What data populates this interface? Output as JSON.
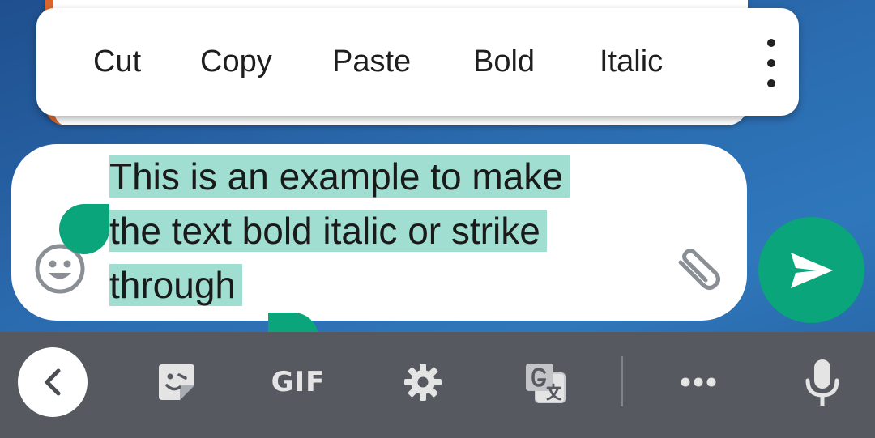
{
  "context_menu": {
    "items": [
      "Cut",
      "Copy",
      "Paste",
      "Bold",
      "Italic"
    ],
    "more_icon": "more-vert-icon"
  },
  "compose": {
    "lines": [
      "This is an example to make",
      "the text bold italic or strike",
      "through"
    ],
    "emoji_icon": "emoji-face-icon",
    "attach_icon": "paperclip-icon",
    "send_icon": "send-icon"
  },
  "keyboard_toolbar": {
    "back_icon": "chevron-left-icon",
    "sticker_icon": "sticker-icon",
    "gif_label": "GIF",
    "settings_icon": "gear-icon",
    "translate_icon": "translate-icon",
    "more_icon": "more-horiz-icon",
    "mic_icon": "microphone-icon"
  },
  "colors": {
    "accent_green": "#0aa57a",
    "selection": "#9fded0",
    "keyboard_bar": "#56595f"
  }
}
